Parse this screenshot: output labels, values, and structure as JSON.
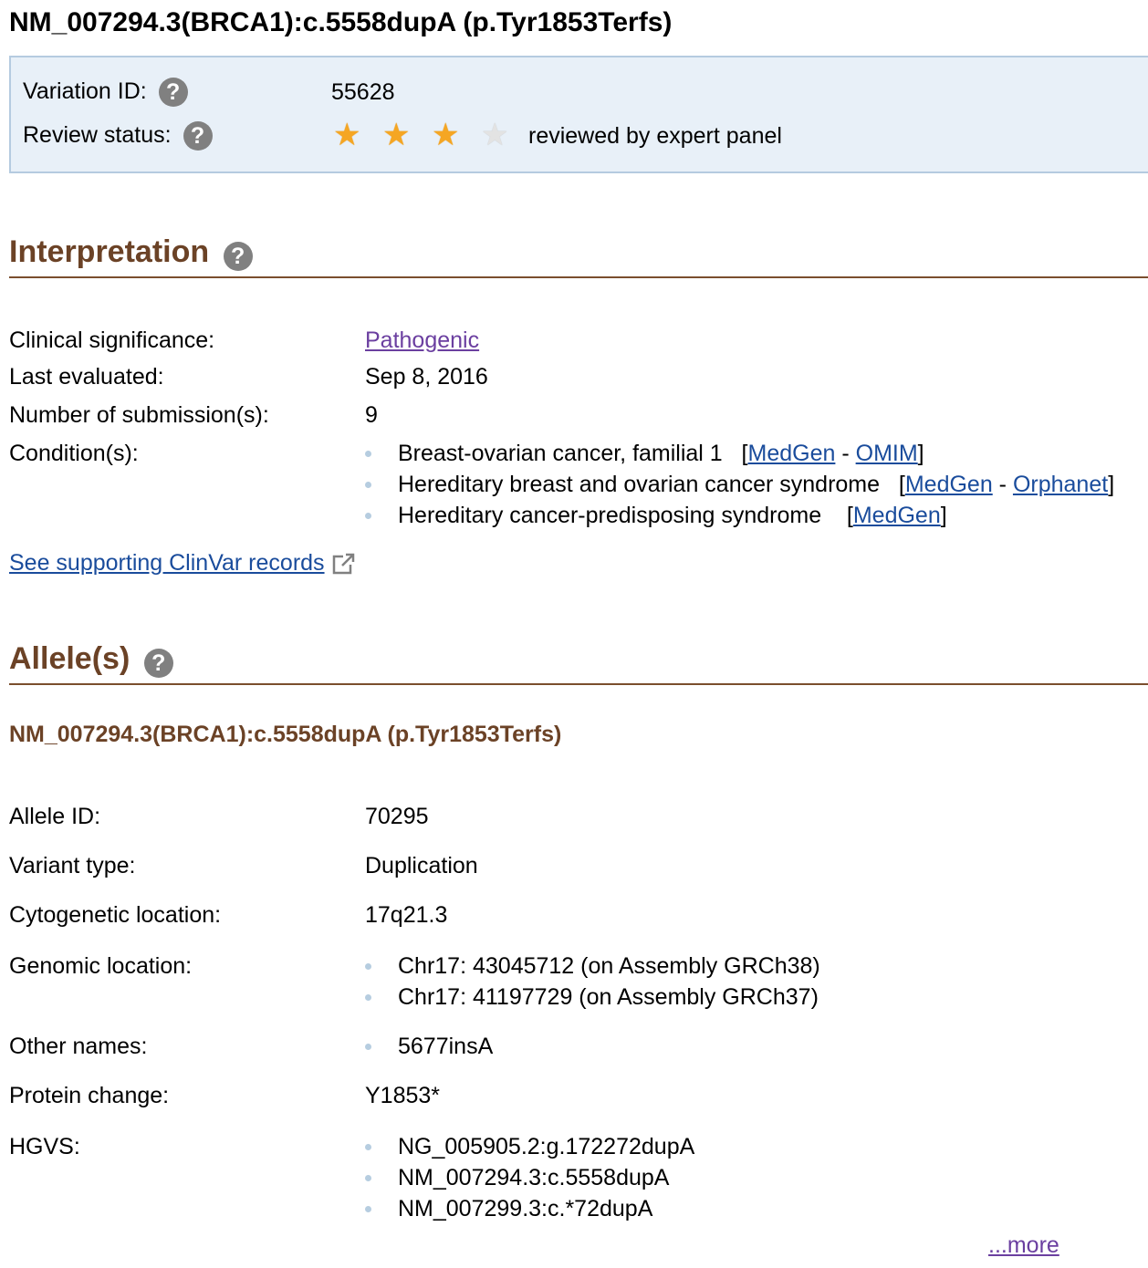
{
  "header": {
    "title": "NM_007294.3(BRCA1):c.5558dupA (p.Tyr1853Terfs)"
  },
  "summary": {
    "variation_id_label": "Variation ID:",
    "variation_id": "55628",
    "review_status_label": "Review status:",
    "stars_filled": 3,
    "stars_total": 4,
    "review_status": "reviewed by expert panel"
  },
  "interpretation": {
    "heading": "Interpretation",
    "clinical_significance_label": "Clinical significance:",
    "clinical_significance": "Pathogenic",
    "last_evaluated_label": "Last evaluated:",
    "last_evaluated": "Sep 8, 2016",
    "submissions_label": "Number of submission(s):",
    "submissions": "9",
    "conditions_label": "Condition(s):",
    "conditions": [
      {
        "name": "Breast-ovarian cancer, familial 1",
        "links": [
          "MedGen",
          "OMIM"
        ]
      },
      {
        "name": "Hereditary breast and ovarian cancer syndrome",
        "links": [
          "MedGen",
          "Orphanet"
        ]
      },
      {
        "name": "Hereditary cancer-predisposing syndrome",
        "links": [
          "MedGen"
        ]
      }
    ],
    "supporting_link": "See supporting ClinVar records"
  },
  "alleles": {
    "heading": "Allele(s)",
    "allele_name": "NM_007294.3(BRCA1):c.5558dupA (p.Tyr1853Terfs)",
    "allele_id_label": "Allele ID:",
    "allele_id": "70295",
    "variant_type_label": "Variant type:",
    "variant_type": "Duplication",
    "cytogenetic_label": "Cytogenetic location:",
    "cytogenetic": "17q21.3",
    "genomic_label": "Genomic location:",
    "genomic": [
      "Chr17: 43045712 (on Assembly GRCh38)",
      "Chr17: 41197729 (on Assembly GRCh37)"
    ],
    "other_names_label": "Other names:",
    "other_names": [
      "5677insA"
    ],
    "protein_change_label": "Protein change:",
    "protein_change": "Y1853*",
    "hgvs_label": "HGVS:",
    "hgvs": [
      "NG_005905.2:g.172272dupA",
      "NM_007294.3:c.5558dupA",
      "NM_007299.3:c.*72dupA"
    ],
    "more_link": "...more"
  },
  "icons": {
    "help": "question-circle-icon",
    "star": "star-icon",
    "external": "external-link-icon"
  },
  "colors": {
    "section_heading": "#6b4226",
    "link": "#1a4c9c",
    "visited_link": "#6b3fa0",
    "star_filled": "#f5a623",
    "summary_bg": "#e8f0f8"
  }
}
